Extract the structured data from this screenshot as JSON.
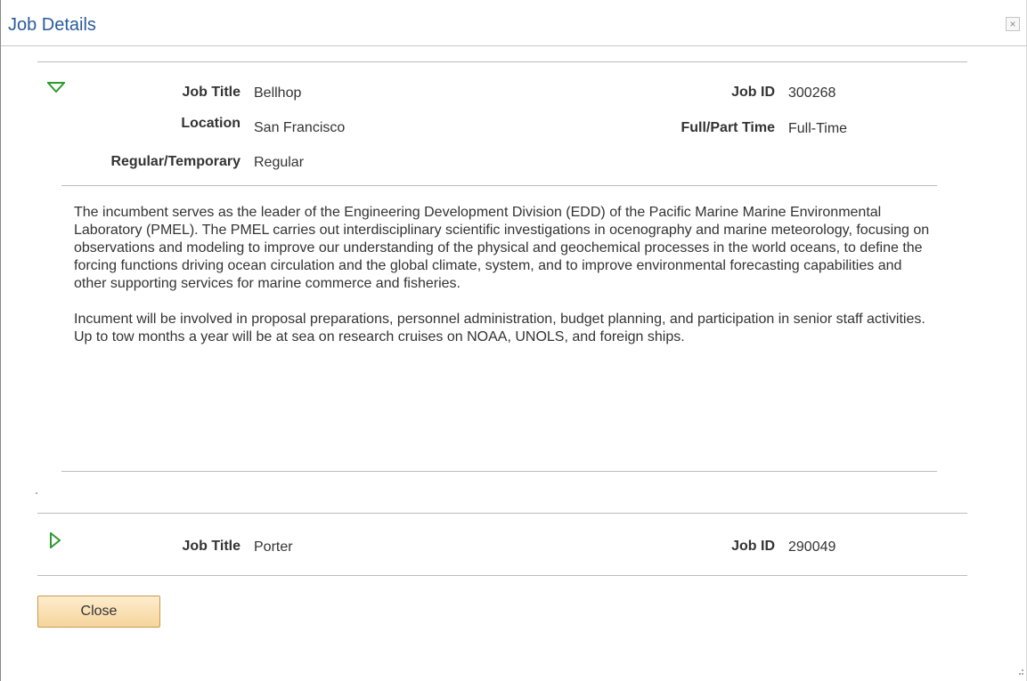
{
  "window": {
    "title": "Job Details",
    "close_icon_glyph": "×"
  },
  "jobs": [
    {
      "expanded": true,
      "fields": {
        "job_title_label": "Job Title",
        "job_title": "Bellhop",
        "job_id_label": "Job ID",
        "job_id": "300268",
        "location_label": "Location",
        "location": "San Francisco",
        "full_part_label": "Full/Part Time",
        "full_part": "Full-Time",
        "regular_temp_label": "Regular/Temporary",
        "regular_temp": "Regular"
      },
      "description": [
        "The incumbent serves as the leader of the Engineering Development Division (EDD) of the Pacific Marine Marine Environmental Laboratory (PMEL).  The PMEL carries out interdisciplinary scientific investigations in ocenography and marine meteorology, focusing on observations and modeling to improve our understanding of the physical and geochemical processes in the world oceans, to define the forcing functions driving ocean circulation and the global climate, system, and to improve environmental forecasting capabilities and other supporting services for marine commerce and fisheries.",
        "Incument will be involved in proposal preparations, personnel administration, budget planning, and participation in senior staff activities.  Up to tow months a year will be at sea on research cruises on NOAA, UNOLS, and foreign ships."
      ]
    },
    {
      "expanded": false,
      "fields": {
        "job_title_label": "Job Title",
        "job_title": "Porter",
        "job_id_label": "Job ID",
        "job_id": "290049"
      }
    }
  ],
  "actions": {
    "close_label": "Close"
  },
  "colors": {
    "title": "#2a5b98",
    "toggle_icon": "#2f9a2f",
    "button_bg": "#f6d59c",
    "divider": "#bdbdbd"
  },
  "icons": {
    "expanded": "triangle-down-icon",
    "collapsed": "triangle-right-icon",
    "close": "close-icon"
  }
}
